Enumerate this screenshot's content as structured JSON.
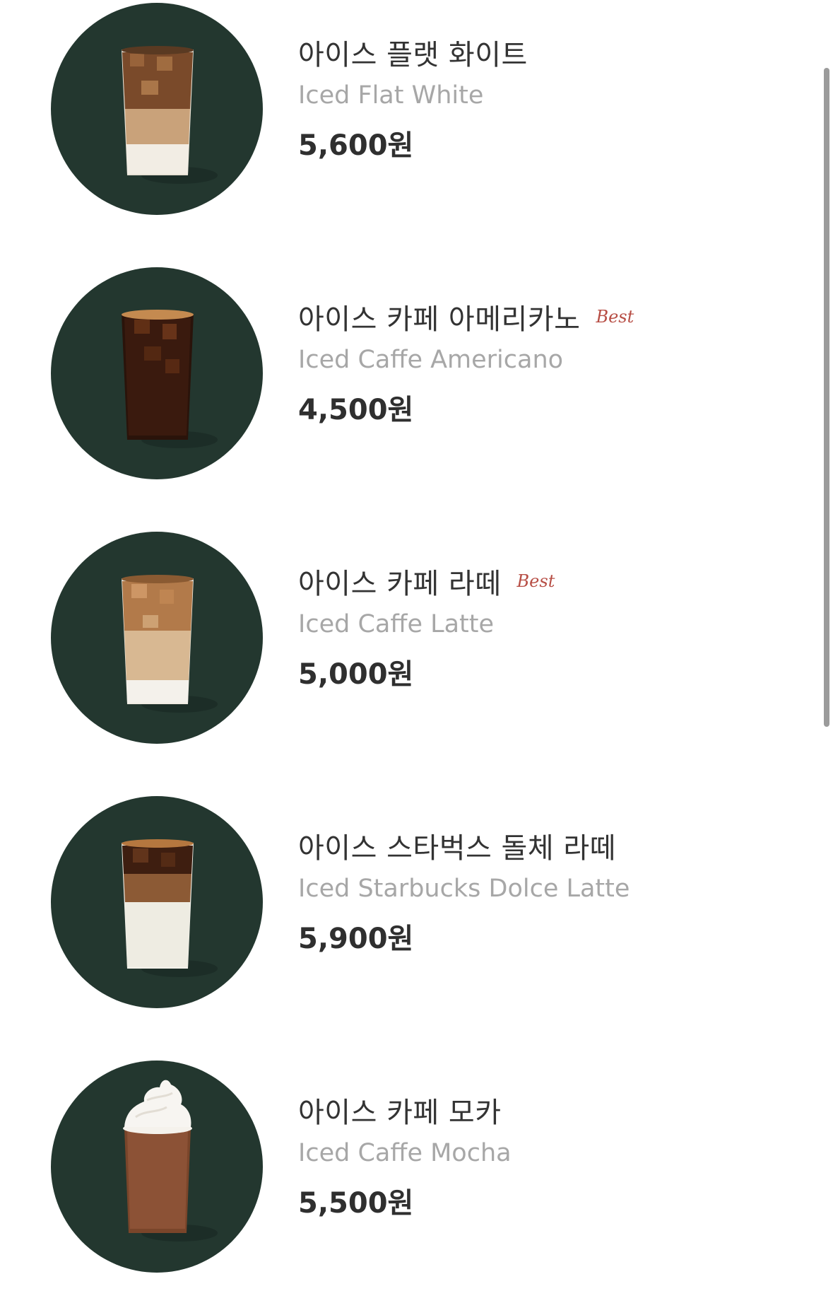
{
  "menu": {
    "items": [
      {
        "name_ko": "아이스 플랫 화이트",
        "name_en": "Iced Flat White",
        "price": "5,600원",
        "badge": "",
        "image_icon": "iced-flat-white-drink-icon"
      },
      {
        "name_ko": "아이스 카페 아메리카노",
        "name_en": "Iced Caffe Americano",
        "price": "4,500원",
        "badge": "Best",
        "image_icon": "iced-americano-drink-icon"
      },
      {
        "name_ko": "아이스 카페 라떼",
        "name_en": "Iced Caffe Latte",
        "price": "5,000원",
        "badge": "Best",
        "image_icon": "iced-latte-drink-icon"
      },
      {
        "name_ko": "아이스 스타벅스 돌체 라떼",
        "name_en": "Iced Starbucks Dolce Latte",
        "price": "5,900원",
        "badge": "",
        "image_icon": "iced-dolce-latte-drink-icon"
      },
      {
        "name_ko": "아이스 카페 모카",
        "name_en": "Iced Caffe Mocha",
        "price": "5,500원",
        "badge": "",
        "image_icon": "iced-mocha-drink-icon"
      }
    ]
  },
  "colors": {
    "thumb_background": "#23372f",
    "badge": "#b74e45",
    "title": "#333333",
    "subtitle": "#a7a7a7",
    "price": "#2f2f2f"
  }
}
